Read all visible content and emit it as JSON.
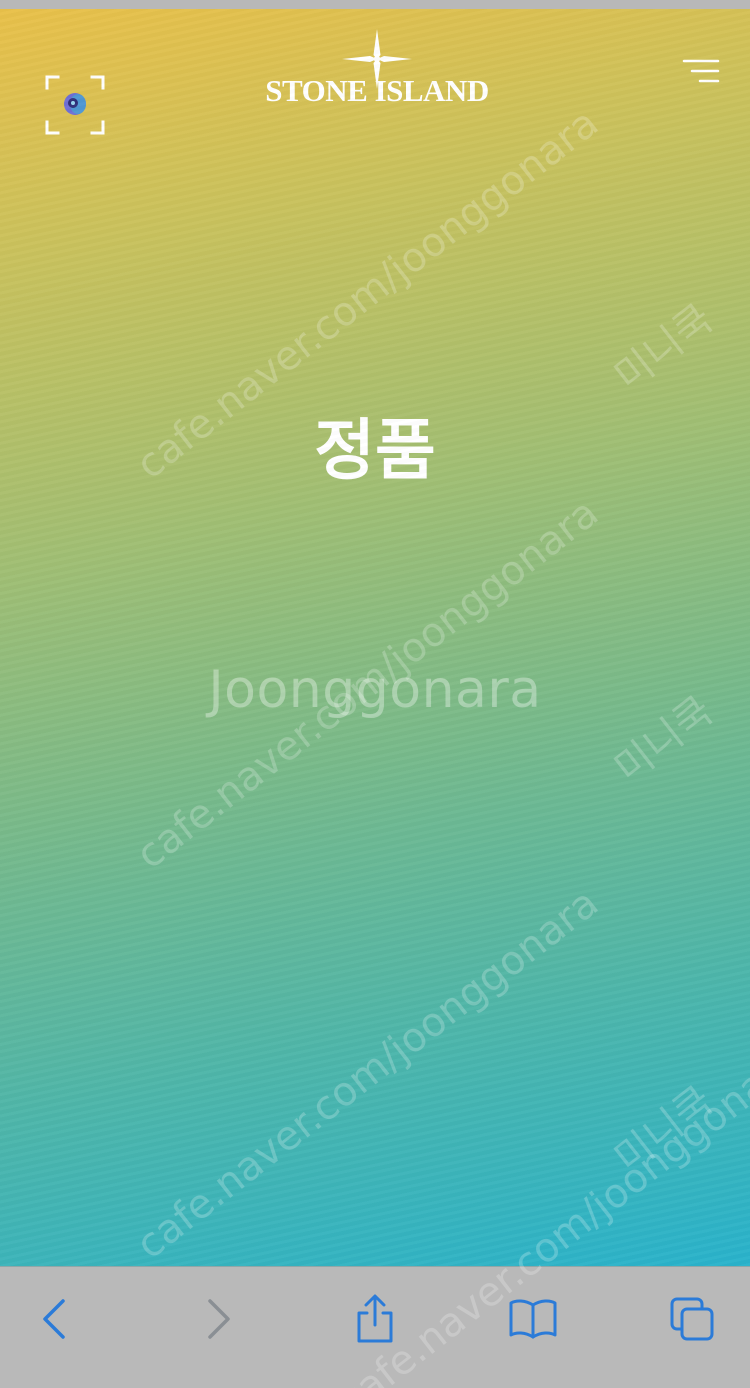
{
  "header": {
    "brand_name": "STONE ISLAND",
    "scan_icon": "camera-scan-icon",
    "logo_icon": "compass-star-icon",
    "menu_icon": "hamburger-menu-icon"
  },
  "main": {
    "headline": "정품"
  },
  "watermark": {
    "brand": "Joonggonara",
    "url": "cafe.naver.com/joonggonara",
    "korean": "미니쿡"
  },
  "toolbar": {
    "items": [
      {
        "icon": "back-chevron-icon",
        "enabled": true
      },
      {
        "icon": "forward-chevron-icon",
        "enabled": false
      },
      {
        "icon": "share-icon",
        "enabled": true
      },
      {
        "icon": "bookmarks-icon",
        "enabled": true
      },
      {
        "icon": "tabs-icon",
        "enabled": true
      }
    ],
    "accent_color": "#2b7bd8",
    "disabled_color": "#8a8f94"
  },
  "colors": {
    "gradient_top": "#e9c14a",
    "gradient_bottom": "#29b3cc",
    "toolbar_bg": "#b9b9b9"
  }
}
